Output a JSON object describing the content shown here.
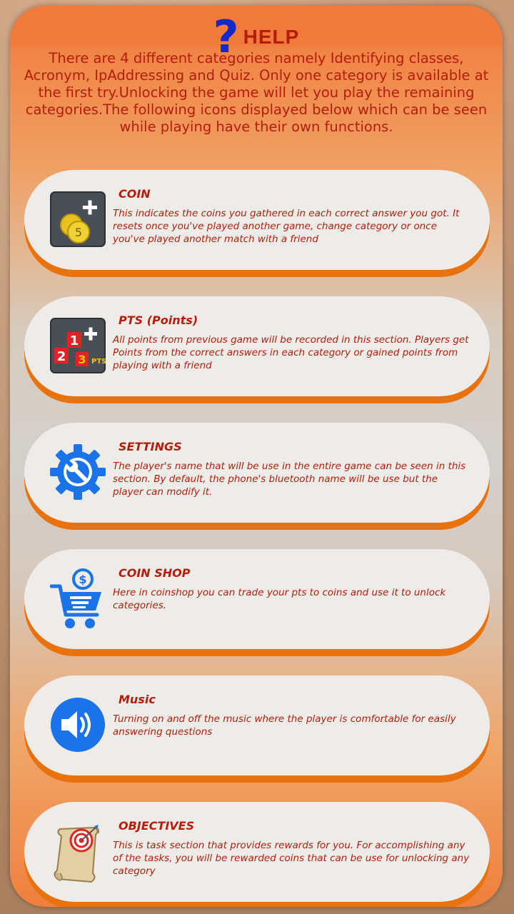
{
  "header": {
    "title": "HELP",
    "help_icon": "question-mark-icon"
  },
  "intro": {
    "text": "There are 4 different categories namely Identifying classes, Acronym, IpAddressing and Quiz. Only one category is available at the first try.Unlocking the game will let you play the remaining categories.The following icons displayed below which can be seen while playing have their own functions."
  },
  "items": [
    {
      "title": "COIN",
      "icon": "coin-plus-icon",
      "description": " This indicates the coins you gathered in each correct answer you got. It resets once you've played another game, change category or once you've played another match with a friend"
    },
    {
      "title": "PTS (Points)",
      "icon": "points-plus-icon",
      "icon_label": "PTS",
      "description": "All points from previous game will be recorded in this section. Players get Points from the correct answers in each category or gained points from playing with a friend"
    },
    {
      "title": "SETTINGS",
      "icon": "settings-gear-icon",
      "description": "The player's name that will be use in the entire game can be seen in this section. By default, the phone's bluetooth name will be use but the player can modify it."
    },
    {
      "title": "COIN SHOP",
      "icon": "shopping-cart-icon",
      "description": "Here in coinshop you can trade your pts to coins and use it  to unlock categories."
    },
    {
      "title": "Music",
      "icon": "speaker-icon",
      "description": "Turning on and off the music where the player is comfortable for easily answering questions"
    },
    {
      "title": "OBJECTIVES",
      "icon": "scroll-target-icon",
      "description": "This is task section that provides rewards for you. For accomplishing any of the tasks, you will be rewarded coins that can be use for unlocking any category"
    }
  ],
  "colors": {
    "title_red": "#b51d0a",
    "question_blue": "#1528c8",
    "card_fill": "#eeece8",
    "card_rim": "#e8720e",
    "icon_blue": "#1a73e8"
  }
}
